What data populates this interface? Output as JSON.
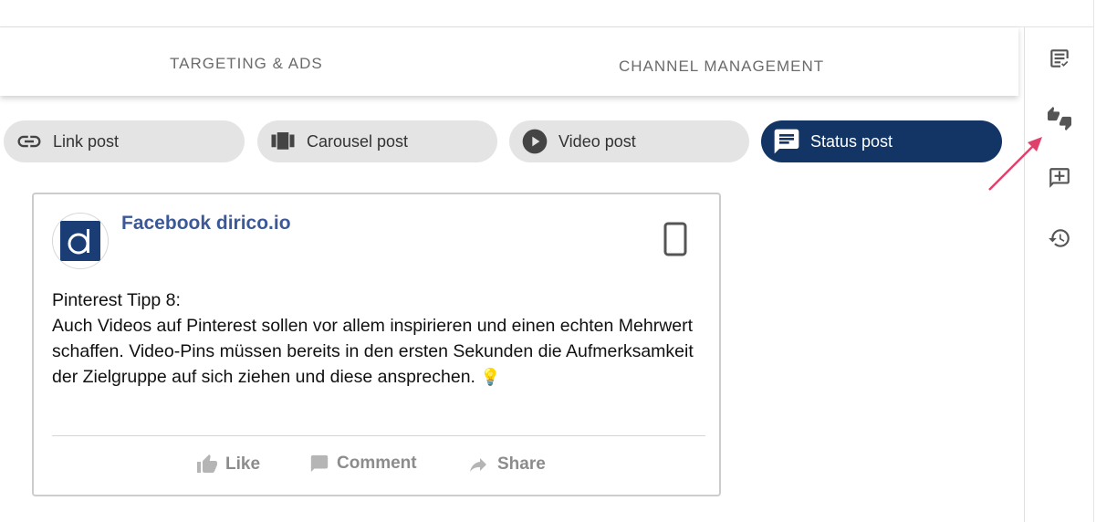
{
  "tabs": [
    {
      "label": "TARGETING & ADS"
    },
    {
      "label": "CHANNEL MANAGEMENT"
    }
  ],
  "post_types": [
    {
      "label": "Link post",
      "icon": "link-icon"
    },
    {
      "label": "Carousel post",
      "icon": "carousel-icon"
    },
    {
      "label": "Video post",
      "icon": "play-circle-icon"
    },
    {
      "label": "Status post",
      "icon": "message-icon",
      "active": true
    }
  ],
  "preview": {
    "page_name": "Facebook dirico.io",
    "avatar_letter": "d",
    "post_text": "Pinterest Tipp 8:\nAuch Videos auf Pinterest sollen vor allem inspirieren und einen echten Mehrwert schaffen. Video-Pins müssen bereits in den ersten Sekunden die Aufmerksamkeit der Zielgruppe auf sich ziehen und diese ansprechen.",
    "emoji": "💡",
    "actions": {
      "like": "Like",
      "comment": "Comment",
      "share": "Share"
    }
  },
  "sidebar_icons": [
    "notes-check-icon",
    "thumbs-up-down-icon",
    "add-comment-icon",
    "history-icon"
  ],
  "colors": {
    "active_pill": "#133565",
    "brand_link": "#3b5998",
    "arrow": "#e0416b"
  }
}
